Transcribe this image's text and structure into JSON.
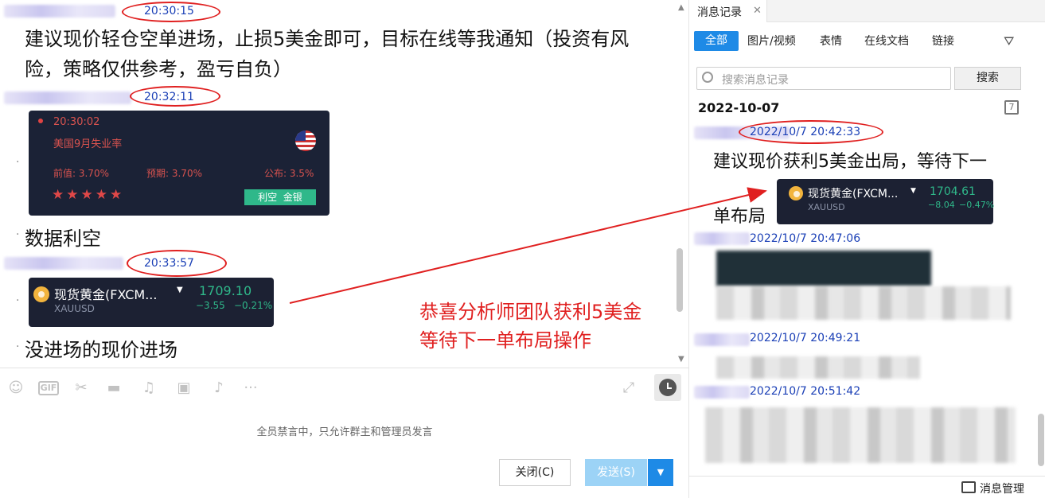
{
  "chat": {
    "times": [
      "20:30:15",
      "20:32:11",
      "20:33:57"
    ],
    "message1": "建议现价轻仓空单进场，止损5美金即可，目标在线等我通知（投资有风险，策略仅供参考，盈亏自负）",
    "message2": "数据利空",
    "message3": "没进场的现价进场",
    "econ_card": {
      "time": "20:30:02",
      "title": "美国9月失业率",
      "prev": "前值: 3.70%",
      "expect": "预期: 3.70%",
      "actual": "公布: 3.5%",
      "tag": "利空  金银",
      "stars": "★★★★★"
    },
    "gold_card": {
      "name": "现货黄金(FXCM...",
      "symbol": "XAUUSD",
      "price": "1709.10",
      "change": "−3.55",
      "pct": "−0.21%"
    },
    "annotation": "恭喜分析师团队获利5美金\n等待下一单布局操作",
    "annotation_line1": "恭喜分析师团队获利5美金",
    "annotation_line2": "等待下一单布局操作",
    "mute_notice": "全员禁言中，只允许群主和管理员发言",
    "close_button": "关闭(C)",
    "send_button": "发送(S)"
  },
  "history": {
    "tab_title": "消息记录",
    "filters": [
      "全部",
      "图片/视频",
      "表情",
      "在线文档",
      "链接"
    ],
    "search_placeholder": "搜索消息记录",
    "search_button": "搜索",
    "date_header": "2022-10-07",
    "entries": [
      {
        "time": "2022/10/7 20:42:33",
        "text": "建议现价获利5美金出局，等待下一单布局"
      },
      {
        "time": "2022/10/7 20:47:06"
      },
      {
        "time": "2022/10/7 20:49:21"
      },
      {
        "time": "2022/10/7 20:51:42"
      }
    ],
    "entry1_line1": "建议现价获利5美金出局，等待下一",
    "entry1_line2": "单布局",
    "gold_card": {
      "name": "现货黄金(FXCM...",
      "symbol": "XAUUSD",
      "price": "1704.61",
      "change": "−8.04",
      "pct": "−0.47%"
    },
    "manage_label": "消息管理"
  },
  "colors": {
    "accent_blue": "#1e8ae6",
    "annotation_red": "#e02020",
    "card_bg": "#1b2236",
    "up_green": "#2fb88a"
  }
}
